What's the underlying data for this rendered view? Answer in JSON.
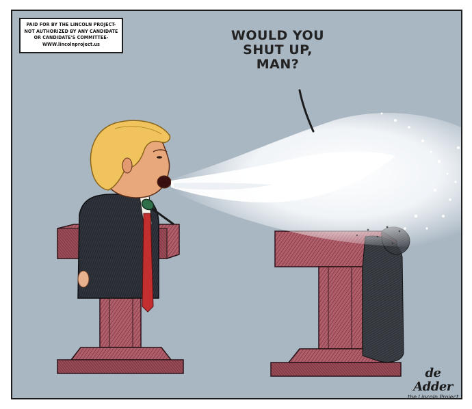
{
  "disclaimer": {
    "lines": [
      "PAID FOR BY THE LINCOLN PROJECT-",
      "NOT AUTHORIZED BY ANY CANDIDATE",
      "OR CANDIDATE'S COMMITTEE-",
      "WWW.lincolnproject.us"
    ]
  },
  "speech_bubble": {
    "lines": [
      "WOULD YOU",
      "SHUT UP,",
      "MAN?"
    ]
  },
  "signature": {
    "artist": "de Adder",
    "org": "the Lincoln Project"
  },
  "colors": {
    "background": "#a9b7c3",
    "podium": "#a2515e",
    "spray": "#ffffff",
    "suit": "#2c3038",
    "tie": "#c32f2f"
  }
}
